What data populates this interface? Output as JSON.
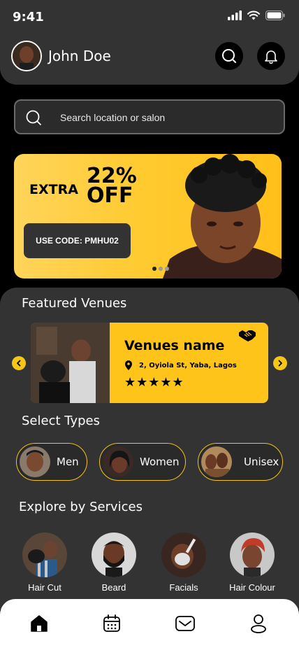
{
  "status_bar": {
    "time": "9:41"
  },
  "header": {
    "user_name": "John Doe"
  },
  "search": {
    "placeholder": "Search location or salon"
  },
  "banner": {
    "extra_label": "EXTRA",
    "percent": "22%",
    "off_label": "OFF",
    "code_text": "USE CODE: PMHU02",
    "slides_count": 3,
    "active_slide": 1
  },
  "featured": {
    "title": "Featured Venues",
    "venue": {
      "name": "Venues name",
      "address": "2, Oyiola St, Yaba, Lagos",
      "rating": 5,
      "stars": "★★★★★"
    }
  },
  "types": {
    "title": "Select Types",
    "items": [
      {
        "label": "Men"
      },
      {
        "label": "Women"
      },
      {
        "label": "Unisex"
      }
    ]
  },
  "services": {
    "title": "Explore by Services",
    "items": [
      {
        "label": "Hair Cut"
      },
      {
        "label": "Beard"
      },
      {
        "label": "Facials"
      },
      {
        "label": "Hair Colour"
      }
    ]
  },
  "nav": {
    "items": [
      {
        "icon": "home-icon",
        "active": true
      },
      {
        "icon": "calendar-icon",
        "active": false
      },
      {
        "icon": "mail-icon",
        "active": false
      },
      {
        "icon": "profile-icon",
        "active": false
      }
    ]
  },
  "colors": {
    "accent": "#F5C518",
    "panel": "#333333",
    "background": "#000000"
  }
}
